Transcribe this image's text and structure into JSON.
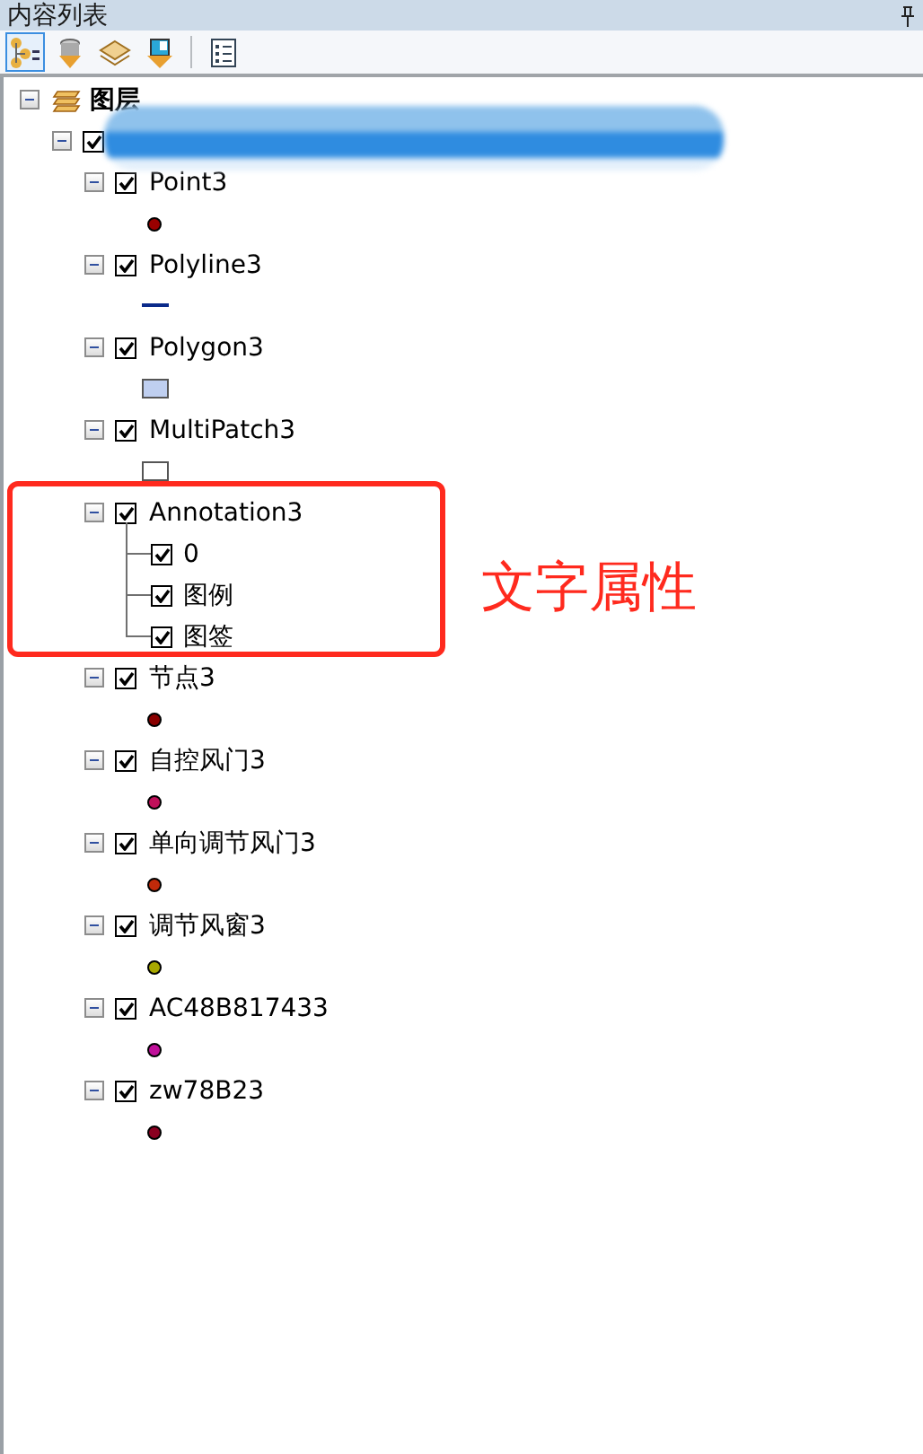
{
  "panel": {
    "title": "内容列表"
  },
  "toolbar": [
    {
      "kind": "draw-order",
      "selected": true
    },
    {
      "kind": "source",
      "selected": false
    },
    {
      "kind": "visibility",
      "selected": false
    },
    {
      "kind": "selection",
      "selected": false
    },
    {
      "kind": "options",
      "selected": false
    }
  ],
  "tree": {
    "label": "图层",
    "expanded": true,
    "frame": {
      "checked": true,
      "expanded": true,
      "redacted": true,
      "layers": [
        {
          "label": "Point3",
          "kind": "point",
          "checked": true,
          "expanded": true,
          "color": "#9a0000"
        },
        {
          "label": "Polyline3",
          "kind": "line",
          "checked": true,
          "expanded": true,
          "color": "#0a2a8a"
        },
        {
          "label": "Polygon3",
          "kind": "polygon",
          "checked": true,
          "expanded": true,
          "color": "#bfcff0"
        },
        {
          "label": "MultiPatch3",
          "kind": "multipatch",
          "checked": true,
          "expanded": true
        },
        {
          "label": "Annotation3",
          "kind": "annotation",
          "checked": true,
          "expanded": true,
          "highlighted": true,
          "children": [
            {
              "label": "0",
              "checked": true
            },
            {
              "label": "图例",
              "checked": true
            },
            {
              "label": "图签",
              "checked": true
            }
          ]
        },
        {
          "label": "节点3",
          "kind": "point",
          "checked": true,
          "expanded": true,
          "color": "#8a0000"
        },
        {
          "label": "自控风门3",
          "kind": "point",
          "checked": true,
          "expanded": true,
          "color": "#c0105a"
        },
        {
          "label": "单向调节风门3",
          "kind": "point",
          "checked": true,
          "expanded": true,
          "color": "#c02a0a"
        },
        {
          "label": "调节风窗3",
          "kind": "point",
          "checked": true,
          "expanded": true,
          "color": "#a8a800"
        },
        {
          "label": "AC48B817433",
          "kind": "point",
          "checked": true,
          "expanded": true,
          "color": "#c0109a"
        },
        {
          "label": "zw78B23",
          "kind": "point",
          "checked": true,
          "expanded": true,
          "color": "#8a0020"
        }
      ]
    }
  },
  "callout": {
    "text": "文字属性"
  }
}
